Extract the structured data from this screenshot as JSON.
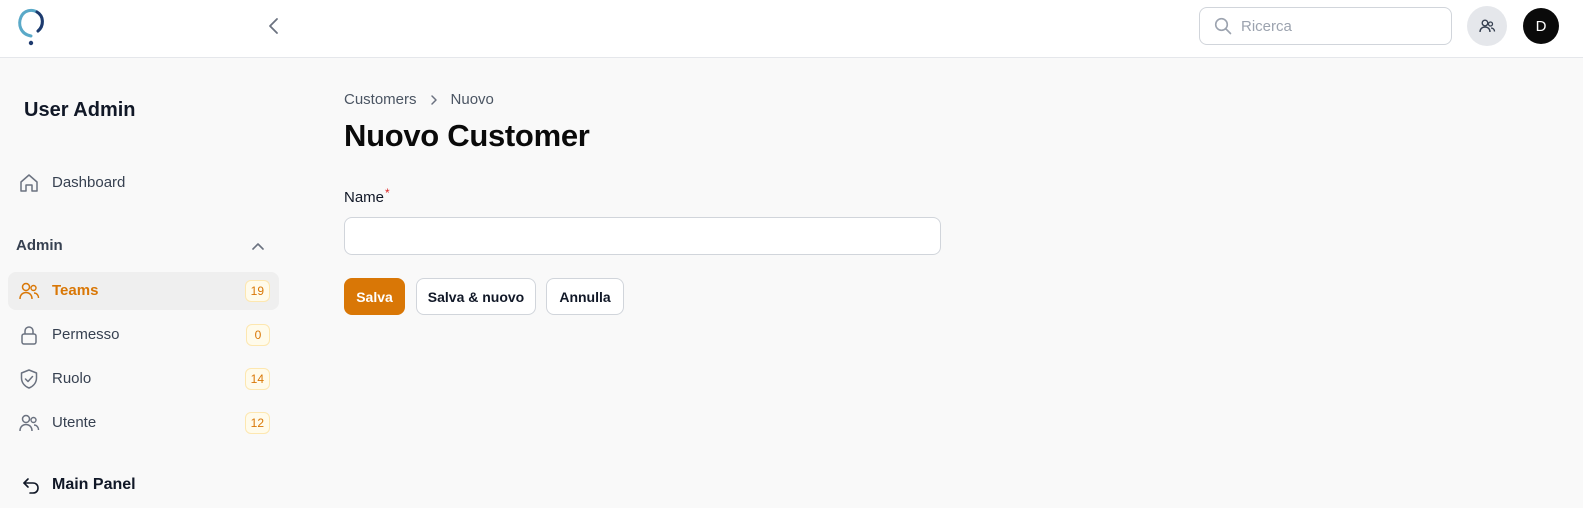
{
  "header": {
    "search": {
      "placeholder": "Ricerca",
      "value": ""
    },
    "avatar_initial": "D"
  },
  "sidebar": {
    "title": "User Admin",
    "dashboard_label": "Dashboard",
    "group": {
      "label": "Admin",
      "items": [
        {
          "label": "Teams",
          "count": "19",
          "icon": "users-icon",
          "active": true
        },
        {
          "label": "Permesso",
          "count": "0",
          "icon": "lock-icon",
          "active": false
        },
        {
          "label": "Ruolo",
          "count": "14",
          "icon": "shield-check-icon",
          "active": false
        },
        {
          "label": "Utente",
          "count": "12",
          "icon": "users-icon",
          "active": false
        }
      ]
    },
    "main_panel_label": "Main Panel"
  },
  "breadcrumb": {
    "items": [
      "Customers",
      "Nuovo"
    ]
  },
  "page": {
    "title": "Nuovo Customer"
  },
  "form": {
    "name_label": "Name",
    "required_mark": "*",
    "name_value": ""
  },
  "actions": {
    "save": "Salva",
    "save_new": "Salva & nuovo",
    "cancel": "Annulla"
  },
  "colors": {
    "accent": "#d97706",
    "badge_bg": "#fffbeb",
    "avatar_bg": "#0a0a0a"
  }
}
